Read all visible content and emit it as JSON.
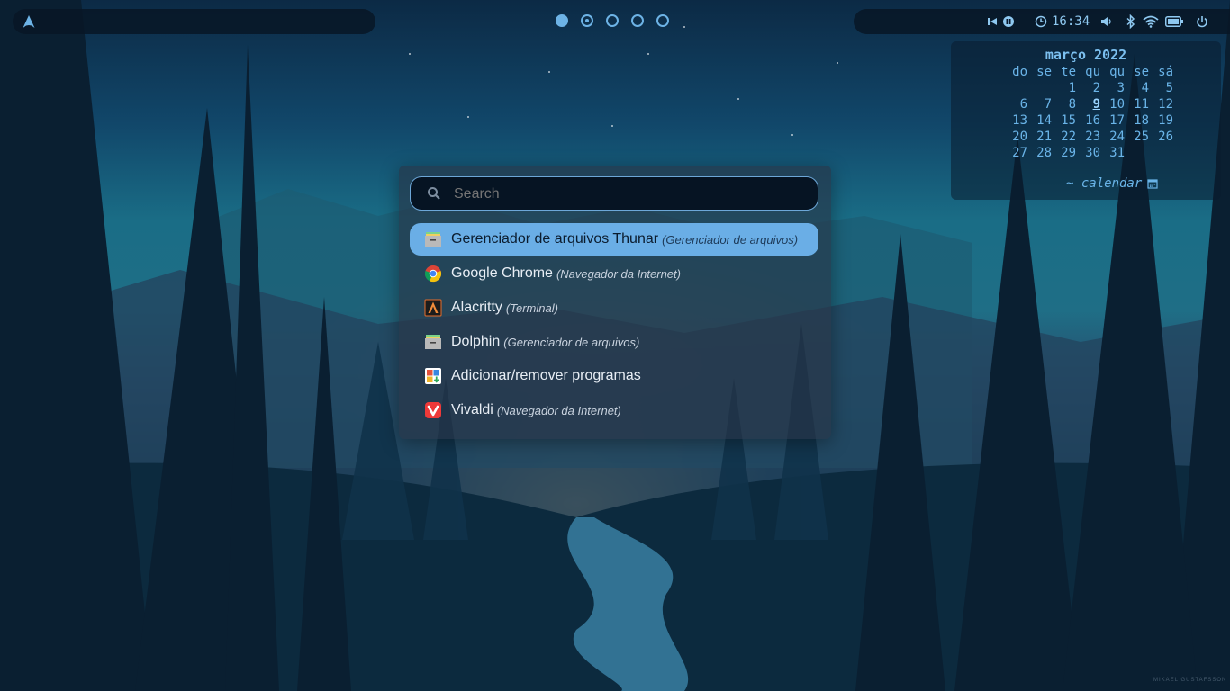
{
  "topbar": {
    "left_icon": "arch-logo-icon",
    "workspaces": [
      {
        "state": "active"
      },
      {
        "state": "occupied"
      },
      {
        "state": "empty"
      },
      {
        "state": "empty"
      },
      {
        "state": "empty"
      }
    ],
    "right": {
      "media_icons": [
        "previous-icon",
        "pause-icon"
      ],
      "clock_icon": "clock-icon",
      "time": "16:34",
      "status_icons": [
        "volume-icon",
        "bluetooth-icon",
        "wifi-icon",
        "battery-icon",
        "power-icon"
      ]
    }
  },
  "calendar": {
    "title": "março 2022",
    "weekdays": [
      "do",
      "se",
      "te",
      "qu",
      "qu",
      "se",
      "sá"
    ],
    "weeks": [
      [
        "",
        "",
        "1",
        "2",
        "3",
        "4",
        "5"
      ],
      [
        "6",
        "7",
        "8",
        "9",
        "10",
        "11",
        "12"
      ],
      [
        "13",
        "14",
        "15",
        "16",
        "17",
        "18",
        "19"
      ],
      [
        "20",
        "21",
        "22",
        "23",
        "24",
        "25",
        "26"
      ],
      [
        "27",
        "28",
        "29",
        "30",
        "31",
        "",
        ""
      ]
    ],
    "today": "9",
    "footer_label": "~ calendar",
    "footer_icon": "calendar-icon"
  },
  "launcher": {
    "search": {
      "placeholder": "Search",
      "value": ""
    },
    "results": [
      {
        "name": "Gerenciador de arquivos Thunar",
        "desc": "(Gerenciador de arquivos)",
        "icon": "file-manager-icon",
        "selected": true
      },
      {
        "name": "Google Chrome",
        "desc": "(Navegador da Internet)",
        "icon": "chrome-icon",
        "selected": false
      },
      {
        "name": "Alacritty",
        "desc": "(Terminal)",
        "icon": "alacritty-icon",
        "selected": false
      },
      {
        "name": "Dolphin",
        "desc": "(Gerenciador de arquivos)",
        "icon": "file-manager-icon",
        "selected": false
      },
      {
        "name": "Adicionar/remover programas",
        "desc": "",
        "icon": "package-manager-icon",
        "selected": false
      },
      {
        "name": "Vivaldi",
        "desc": "(Navegador da Internet)",
        "icon": "vivaldi-icon",
        "selected": false
      }
    ]
  },
  "colors": {
    "accent": "#6aaee6",
    "panel_bg": "#08162a",
    "text_light": "#e8eef5"
  },
  "wallpaper_credit": "MIKAEL GUSTAFSSON"
}
